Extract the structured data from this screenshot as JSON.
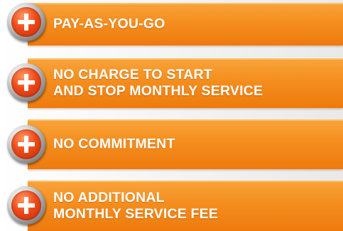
{
  "items": [
    {
      "lines": [
        "PAY-AS-YOU-GO"
      ],
      "icon": "plus-circle-icon"
    },
    {
      "lines": [
        "NO CHARGE TO START",
        "AND STOP MONTHLY SERVICE"
      ],
      "icon": "plus-circle-icon"
    },
    {
      "lines": [
        "NO COMMITMENT"
      ],
      "icon": "plus-circle-icon"
    },
    {
      "lines": [
        "NO ADDITIONAL",
        "MONTHLY SERVICE FEE"
      ],
      "icon": "plus-circle-icon"
    }
  ],
  "colors": {
    "banner": "#f48e1e",
    "badge": "#ef4a1a",
    "text": "#ffffff"
  }
}
